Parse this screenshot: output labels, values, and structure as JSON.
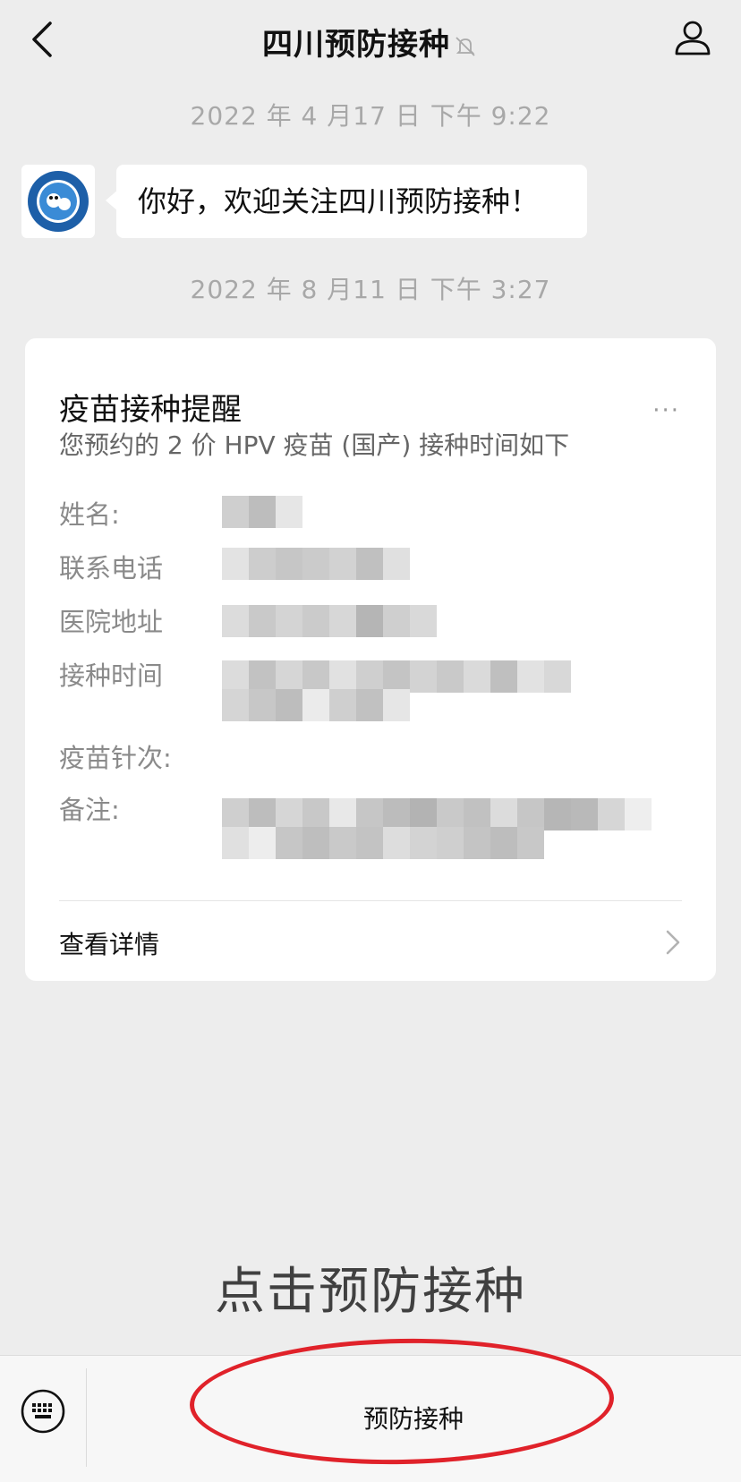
{
  "nav": {
    "title": "四川预防接种"
  },
  "messages": {
    "time1": "2022 年 4 月17 日  下午 9:22",
    "greeting": "你好，欢迎关注四川预防接种！",
    "time2": "2022 年 8 月11 日  下午 3:27"
  },
  "card": {
    "title": "疫苗接种提醒",
    "subtitle": "您预约的 2 价 HPV 疫苗 (国产) 接种时间如下",
    "more": "···",
    "labels": {
      "name": "姓名:",
      "phone": "联系电话",
      "address": "医院地址",
      "time": "接种时间",
      "dose": "疫苗针次:",
      "note": "备注:"
    },
    "detail_link": "查看详情"
  },
  "overlay_text": "点击预防接种",
  "bottom_bar": {
    "menu_label": "预防接种"
  },
  "colors": {
    "background": "#ededed",
    "card": "#ffffff",
    "annotation": "#e0222a",
    "timestamp": "#a8a8a8"
  },
  "icons": [
    "back-arrow-icon",
    "mute-bell-icon",
    "profile-icon",
    "keyboard-icon",
    "chevron-right-icon",
    "more-dots-icon"
  ]
}
